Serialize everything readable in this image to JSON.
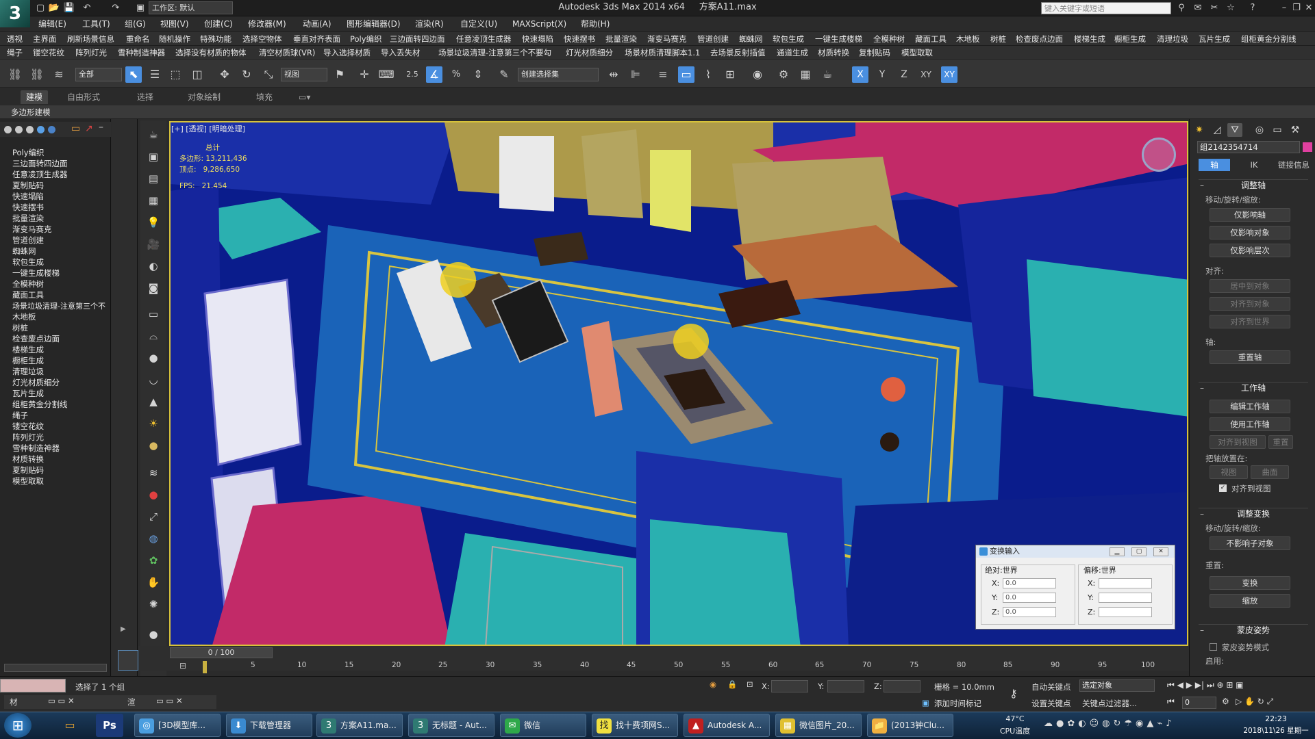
{
  "title_bar": {
    "app_title": "Autodesk 3ds Max  2014 x64",
    "file_name": "方案A11.max",
    "workspace_label": "工作区: 默认",
    "search_placeholder": "键入关键字或短语"
  },
  "menu": [
    "编辑(E)",
    "工具(T)",
    "组(G)",
    "视图(V)",
    "创建(C)",
    "修改器(M)",
    "动画(A)",
    "图形编辑器(D)",
    "渲染(R)",
    "自定义(U)",
    "MAXScript(X)",
    "帮助(H)"
  ],
  "plugin_row1": [
    "透视",
    "主界面",
    "刷新场景信息",
    "重命名",
    "随机操作",
    "特殊功能",
    "选择空物体",
    "垂直对齐表面",
    "Poly编织",
    "三边面转四边面",
    "任意凌顶生成器",
    "快速塌陷",
    "快速摆书",
    "批量渲染",
    "渐变马赛克",
    "管道创建",
    "蜘蛛网",
    "软包生成",
    "一键生成楼梯",
    "全模种树",
    "藏面工具",
    "木地板",
    "树桩",
    "检查废点边面",
    "楼梯生成",
    "橱柜生成",
    "清理垃圾",
    "瓦片生成",
    "组柜黄金分割线"
  ],
  "plugin_row2": [
    "绳子",
    "镂空花纹",
    "阵列灯光",
    "雪种制造神器",
    "选择没有材质的物体",
    "清空材质球(VR)",
    "导入选择材质",
    "导入丢失材",
    "场景垃圾清理-注意第三个不要勾",
    "灯光材质细分",
    "场景材质清理脚本1.1",
    "去场景反射插值",
    "通道生成",
    "材质转换",
    "复制贴码",
    "模型取取"
  ],
  "toolbar": {
    "selection_filter": "全部",
    "ref_coord": "视图",
    "named_selection": "创建选择集",
    "axis_x": "X",
    "axis_y": "Y",
    "axis_z": "Z",
    "axis_xy": "XY",
    "spinner_snap": "2.5",
    "percent": "%"
  },
  "ribbon": {
    "tabs": [
      "建模",
      "自由形式",
      "选择",
      "对象绘制",
      "填充"
    ],
    "active_tab": "建模",
    "sub_label": "多边形建模"
  },
  "left_panel": {
    "items": [
      "Poly编织",
      "三边面转四边面",
      "任意凌顶生成器",
      "夏制贴码",
      "快速塌陷",
      "快速摆书",
      "批量渲染",
      "渐变马赛克",
      "管道创建",
      "蜘蛛网",
      "软包生成",
      "一键生成楼梯",
      "全模种树",
      "藏面工具",
      "场景垃圾清理-注意第三个不",
      "木地板",
      "树桩",
      "检查废点边面",
      "楼梯生成",
      "橱柜生成",
      "清理垃圾",
      "灯光材质细分",
      "瓦片生成",
      "组柜黄金分割线",
      "绳子",
      "镂空花纹",
      "阵列灯光",
      "雪种制造神器",
      "材质转换",
      "夏制贴码",
      "模型取取"
    ]
  },
  "viewport": {
    "label": "[+] [透视] [明暗处理]",
    "stats_title": "总计",
    "polygons_label": "多边形:",
    "polygons_value": "13,211,436",
    "vertices_label": "顶点:",
    "vertices_value": "9,286,650",
    "fps_label": "FPS:",
    "fps_value": "21.454",
    "frame_label": "0 / 100"
  },
  "command_panel": {
    "object_name": "组2142354714",
    "tabs": [
      "轴",
      "IK",
      "链接信息"
    ],
    "rollout_adjust_pivot": "调整轴",
    "move_rotate_scale_label": "移动/旋转/缩放:",
    "affect_pivot_only": "仅影响轴",
    "affect_object_only": "仅影响对象",
    "affect_hierarchy_only": "仅影响层次",
    "align_label": "对齐:",
    "center_to_object": "居中到对象",
    "align_to_object": "对齐到对象",
    "align_to_world": "对齐到世界",
    "pivot_label": "轴:",
    "reset_pivot": "重置轴",
    "rollout_working_pivot": "工作轴",
    "edit_working_pivot": "编辑工作轴",
    "use_working_pivot": "使用工作轴",
    "align_to_view": "对齐到视图",
    "reset": "重置",
    "place_pivot_to": "把轴放置在:",
    "view": "视图",
    "surface": "曲面",
    "align_to_view_check": "对齐到视图",
    "rollout_adjust_transform": "调整变换",
    "move_rotate_scale_label2": "移动/旋转/缩放:",
    "dont_affect_children": "不影响子对象",
    "reset_label": "重置:",
    "transform": "变换",
    "scale": "缩放",
    "rollout_skin_pose": "蒙皮姿势",
    "skin_pose_mode": "蒙皮姿势模式",
    "enable_label": "启用:"
  },
  "transform_dialog": {
    "title": "变换输入",
    "absolute_world": "绝对:世界",
    "offset_world": "偏移:世界",
    "x_label": "X:",
    "y_label": "Y:",
    "z_label": "Z:",
    "abs_x": "0.0",
    "abs_y": "0.0",
    "abs_z": "0.0"
  },
  "timeline": {
    "ticks": [
      "0",
      "5",
      "10",
      "15",
      "20",
      "25",
      "30",
      "35",
      "40",
      "45",
      "50",
      "55",
      "60",
      "65",
      "70",
      "75",
      "80",
      "85",
      "90",
      "95",
      "100"
    ]
  },
  "status_bar": {
    "selection": "选择了 1 个组",
    "x_label": "X:",
    "y_label": "Y:",
    "z_label": "Z:",
    "grid": "栅格 = 10.0mm",
    "auto_key": "自动关键点",
    "set_key": "设置关键点",
    "selected_object": "选定对象",
    "key_filters": "关键点过滤器...",
    "add_time_tag": "添加时间标记",
    "frame_field": "0",
    "left_label": "材",
    "left_label2": "渲"
  },
  "taskbar": {
    "tasks": [
      "[3D模型库...",
      "下载管理器",
      "方案A11.ma...",
      "无标题 - Aut...",
      "微信",
      "找十费项网S...",
      "Autodesk A...",
      "微信图片_20...",
      "(2013钟Clu..."
    ],
    "cpu_temp": "47°C",
    "cpu_label": "CPU温度",
    "time": "22:23",
    "date": "2018\\11\\26 星期一"
  }
}
